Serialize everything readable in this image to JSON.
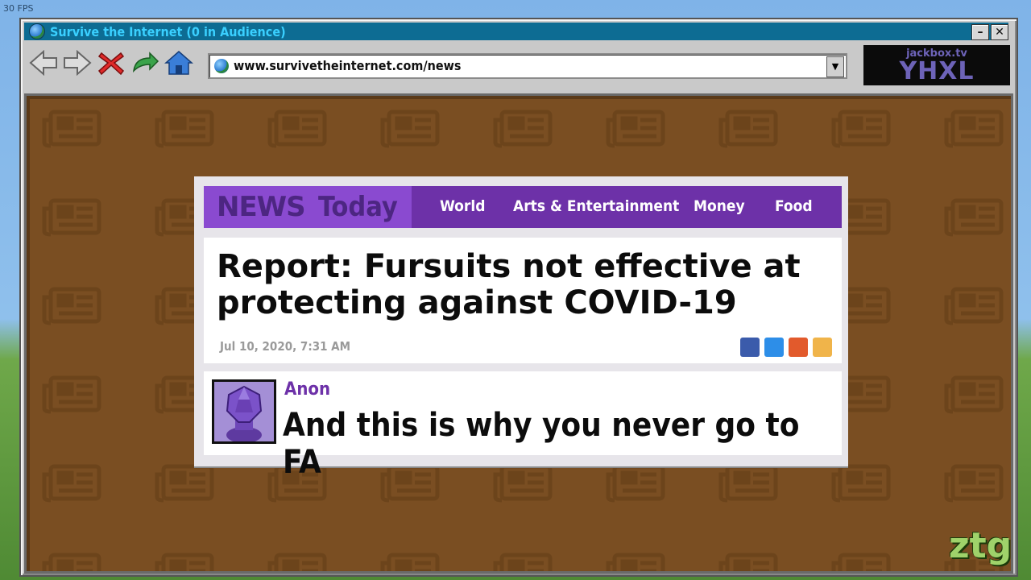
{
  "fps_label": "30 FPS",
  "window": {
    "title": "Survive the Internet  (0 in Audience)"
  },
  "toolbar": {
    "url": "www.survivetheinternet.com/news",
    "back_icon": "back-arrow-icon",
    "forward_icon": "forward-arrow-icon",
    "stop_icon": "stop-x-icon",
    "refresh_icon": "refresh-arrow-icon",
    "home_icon": "home-icon"
  },
  "room": {
    "site": "jackbox.tv",
    "code": "YHXL"
  },
  "article": {
    "logo_news": "NEWS",
    "logo_today": "Today",
    "nav": [
      "World",
      "Arts & Entertainment",
      "Money",
      "Food"
    ],
    "headline": "Report: Fursuits not effective at protecting against COVID-19",
    "date": "Jul 10, 2020, 7:31 AM",
    "share_colors": [
      "#3b5bab",
      "#2d8ee8",
      "#e25a2c",
      "#f0b44a"
    ]
  },
  "comment": {
    "author": "Anon",
    "text": "And this is why you never go to FA"
  },
  "colors": {
    "title_bar": "#0d6c93",
    "title_text": "#3ad0ff",
    "nav_purple": "#6d31a8",
    "logo_purple": "#8a4ad0",
    "background_brown": "#7a4e22"
  },
  "watermark": "ztg"
}
